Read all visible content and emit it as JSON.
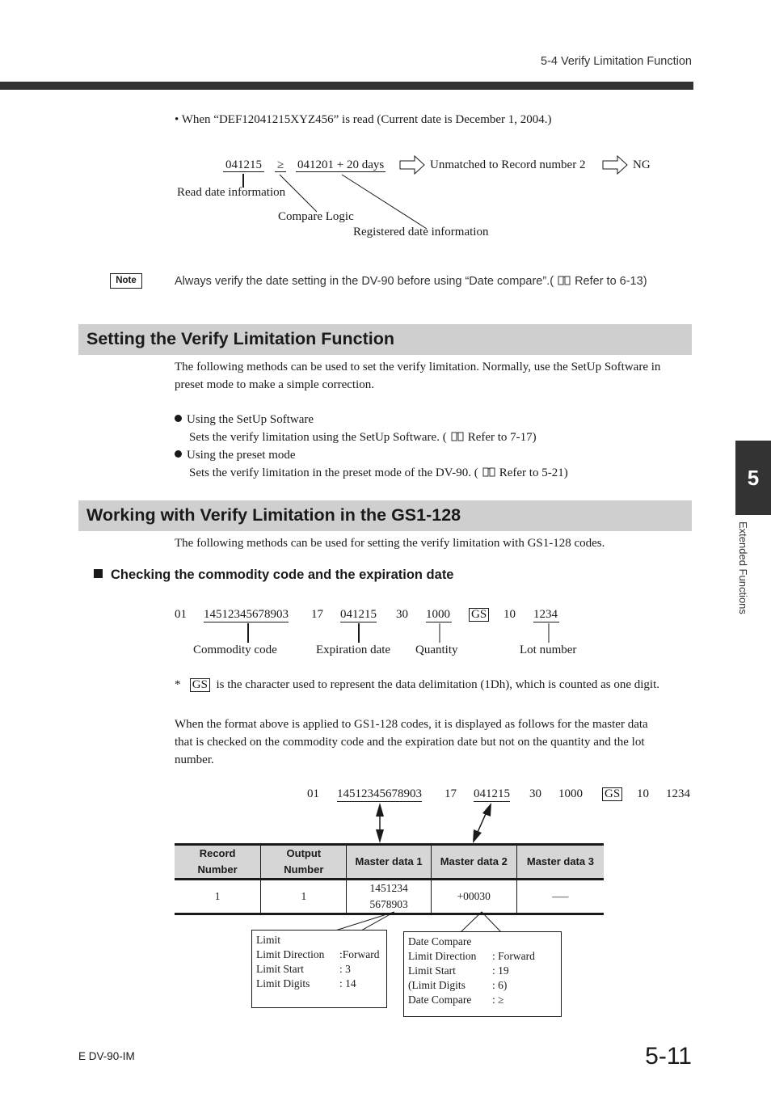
{
  "header": {
    "running_head": "5-4  Verify Limitation Function"
  },
  "example": {
    "bullet": "•  When “DEF12041215XYZ456” is read (Current date is December 1, 2004.)",
    "read_date": "041215",
    "operator": "≥",
    "registered_date": "041201 + 20 days",
    "result_text": "Unmatched to Record number 2",
    "final": "NG",
    "label_read": "Read date information",
    "label_compare": "Compare Logic",
    "label_registered": "Registered date information"
  },
  "note": {
    "badge": "Note",
    "text": "Always verify the date setting in the DV-90 before using “Date compare”.(",
    "ref": "Refer to 6-13)"
  },
  "section1": {
    "title": "Setting the Verify Limitation Function",
    "intro_line1": "The following methods can be used to set the verify limitation. Normally, use the SetUp Software in",
    "intro_line2": "preset mode to make a simple correction.",
    "items": [
      {
        "label": "Using the SetUp Software",
        "desc": "Sets the verify limitation using the SetUp Software. (",
        "ref": "Refer to 7-17)"
      },
      {
        "label": "Using the preset mode",
        "desc": "Sets the verify limitation in the preset mode of the DV-90. (",
        "ref": "Refer to 5-21)"
      }
    ]
  },
  "section2": {
    "title": "Working with Verify Limitation in the GS1-128",
    "intro": "The following methods can be used for setting the verify limitation with GS1-128 codes.",
    "subheading": "Checking the commodity code and the expiration date",
    "code": {
      "ai1": "01",
      "commodity": "14512345678903",
      "ai2": "17",
      "expiry": "041215",
      "ai3": "30",
      "quantity": "1000",
      "gs": "GS",
      "ai4": "10",
      "lot": "1234"
    },
    "labels": {
      "commodity": "Commodity code",
      "expiry": "Expiration date",
      "quantity": "Quantity",
      "lot": "Lot number"
    },
    "gs_note_star": "*",
    "gs_note": "is the character used to represent the data delimitation (1Dh), which is counted as one digit.",
    "para_line1": "When the format above is applied to GS1-128 codes, it is displayed as follows for the master data",
    "para_line2": "that is checked on the commodity code and the expiration date but not on the quantity and the lot",
    "para_line3": "number."
  },
  "table": {
    "headers": [
      {
        "l1": "Record",
        "l2": "Number"
      },
      {
        "l1": "Output",
        "l2": "Number"
      },
      {
        "l1": "Master data 1",
        "l2": ""
      },
      {
        "l1": "Master data 2",
        "l2": ""
      },
      {
        "l1": "Master data 3",
        "l2": ""
      }
    ],
    "row": {
      "record": "1",
      "output": "1",
      "md1_line1": "1451234",
      "md1_line2": "5678903",
      "md2": "+00030",
      "md3": "—–"
    }
  },
  "callout1": {
    "title": "Limit",
    "rows": [
      {
        "k": "Limit Direction",
        "v": ":Forward"
      },
      {
        "k": "Limit Start",
        "v": ": 3"
      },
      {
        "k": "Limit Digits",
        "v": ": 14"
      }
    ]
  },
  "callout2": {
    "title": "Date Compare",
    "rows": [
      {
        "k": "Limit Direction",
        "v": ": Forward"
      },
      {
        "k": "Limit Start",
        "v": ": 19"
      },
      {
        "k": "(Limit Digits",
        "v": ": 6)"
      },
      {
        "k": "Date Compare",
        "v": ": ≥"
      }
    ]
  },
  "chapter": {
    "number": "5",
    "side_label": "Extended Functions"
  },
  "footer": {
    "doc_id": "E DV-90-IM",
    "page": "5-11"
  }
}
